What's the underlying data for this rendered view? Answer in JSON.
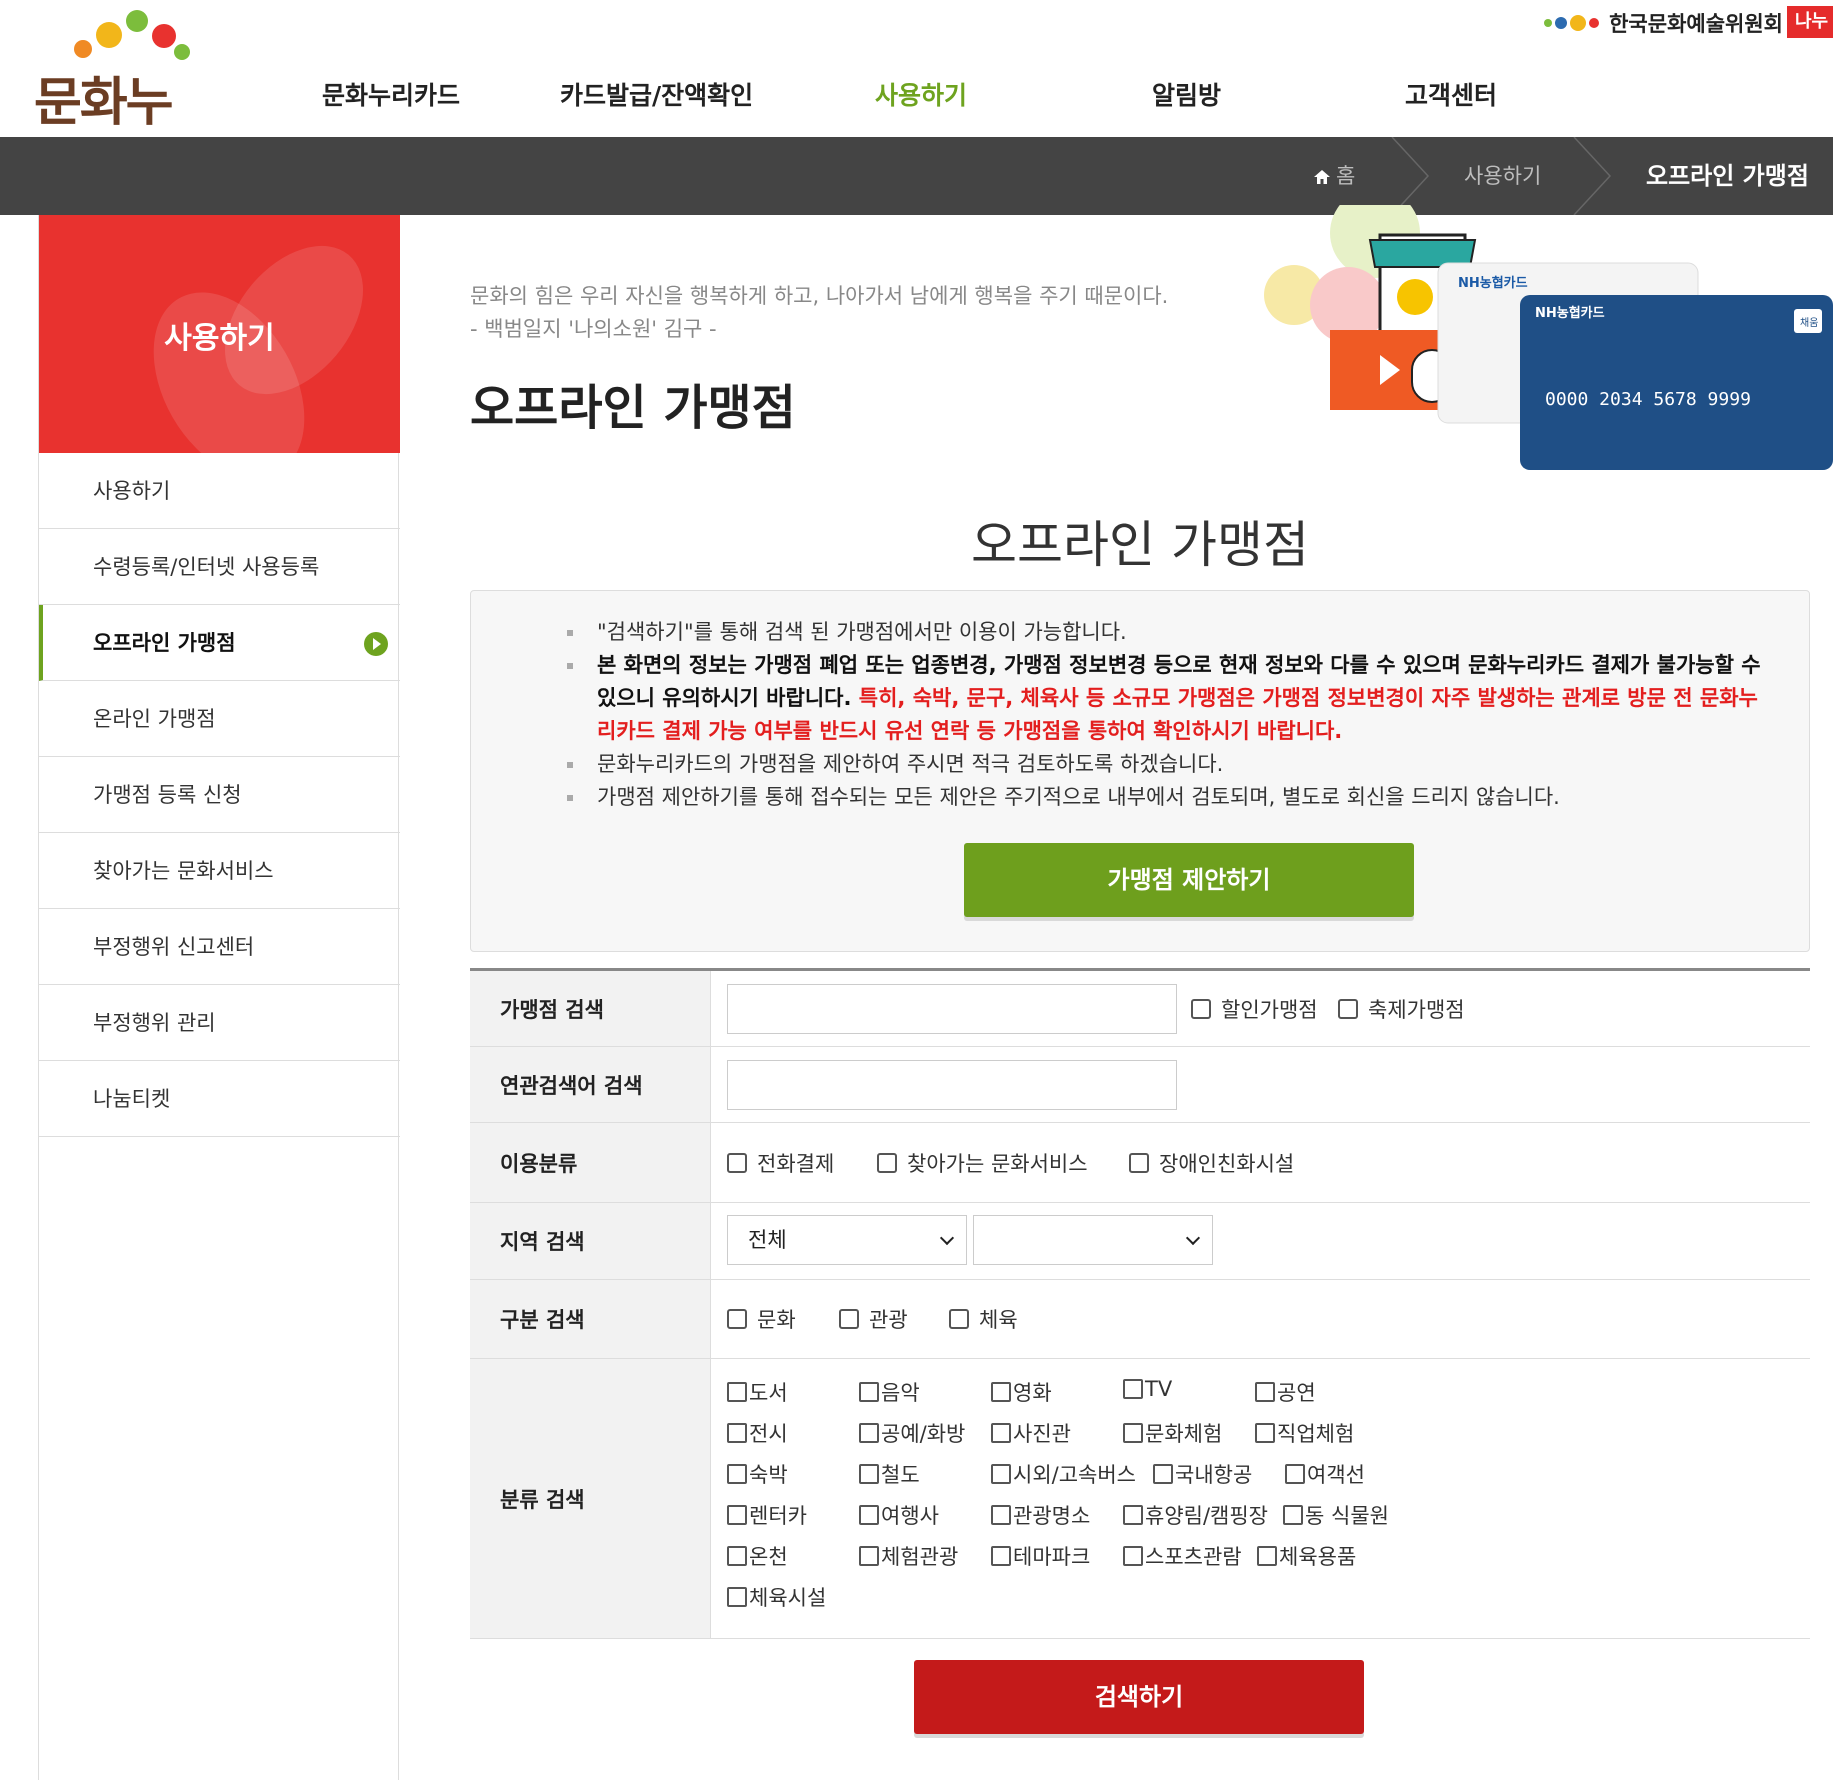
{
  "header": {
    "logo_text": "문화누리",
    "nav": [
      "문화누리카드",
      "카드발급/잔액확인",
      "사용하기",
      "알림방",
      "고객센터"
    ],
    "active_nav_index": 2,
    "org_name": "한국문화예술위원회",
    "org_badge": "나누"
  },
  "breadcrumb": {
    "home": "홈",
    "level1": "사용하기",
    "current": "오프라인 가맹점"
  },
  "sidebar": {
    "title": "사용하기",
    "items": [
      "사용하기",
      "수령등록/인터넷 사용등록",
      "오프라인 가맹점",
      "온라인 가맹점",
      "가맹점 등록 신청",
      "찾아가는 문화서비스",
      "부정행위 신고센터",
      "부정행위 관리",
      "나눔티켓"
    ],
    "active_index": 2
  },
  "intro": {
    "quote_line1": "문화의 힘은 우리 자신을 행복하게 하고, 나아가서 남에게 행복을 주기 때문이다.",
    "quote_line2": "- 백범일지 '나의소원' 김구 -",
    "page_title": "오프라인 가맹점"
  },
  "visual": {
    "card_brand": "NH농협카드",
    "card_number": "0000 2034 5678 9999",
    "card_badge": "채움"
  },
  "section_title": "오프라인 가맹점",
  "notice": {
    "item1": "\"검색하기\"를 통해 검색 된 가맹점에서만 이용이 가능합니다.",
    "item2_bold": "본 화면의 정보는 가맹점 폐업 또는 업종변경, 가맹점 정보변경 등으로 현재 정보와 다를 수 있으며 문화누리카드 결제가 불가능할 수 있으니 유의하시기 바랍니다.",
    "item2_red": " 특히, 숙박, 문구, 체육사 등 소규모 가맹점은 가맹점 정보변경이 자주 발생하는 관계로 방문 전 문화누리카드 결제 가능 여부를 반드시 유선 연락 등 가맹점을 통하여 확인하시기 바랍니다.",
    "item3": "문화누리카드의 가맹점을 제안하여 주시면 적극 검토하도록 하겠습니다.",
    "item4": "가맹점 제안하기를 통해 접수되는 모든 제안은 주기적으로 내부에서 검토되며, 별도로 회신을 드리지 않습니다.",
    "propose_button": "가맹점 제안하기"
  },
  "search": {
    "row_store": {
      "label": "가맹점 검색",
      "input_value": "",
      "discount_label": "할인가맹점",
      "festival_label": "축제가맹점"
    },
    "row_related": {
      "label": "연관검색어 검색",
      "input_value": ""
    },
    "row_usage": {
      "label": "이용분류",
      "options": [
        "전화결제",
        "찾아가는 문화서비스",
        "장애인친화시설"
      ]
    },
    "row_region": {
      "label": "지역 검색",
      "region1": "전체",
      "region2": ""
    },
    "row_division": {
      "label": "구분 검색",
      "options": [
        "문화",
        "관광",
        "체육"
      ]
    },
    "row_category": {
      "label": "분류 검색",
      "options": [
        "도서",
        "음악",
        "영화",
        "TV",
        "공연",
        "전시",
        "공예/화방",
        "사진관",
        "문화체험",
        "직업체험",
        "숙박",
        "철도",
        "시외/고속버스",
        "국내항공",
        "여객선",
        "렌터카",
        "여행사",
        "관광명소",
        "휴양림/캠핑장",
        "동 식물원",
        "온천",
        "체험관광",
        "테마파크",
        "스포츠관람",
        "체육용품",
        "체육시설"
      ]
    },
    "search_button": "검색하기"
  },
  "colors": {
    "accent_green": "#6ea31f",
    "brand_red": "#e8322f",
    "search_red": "#c41a1a",
    "dark_bar": "#444444"
  }
}
